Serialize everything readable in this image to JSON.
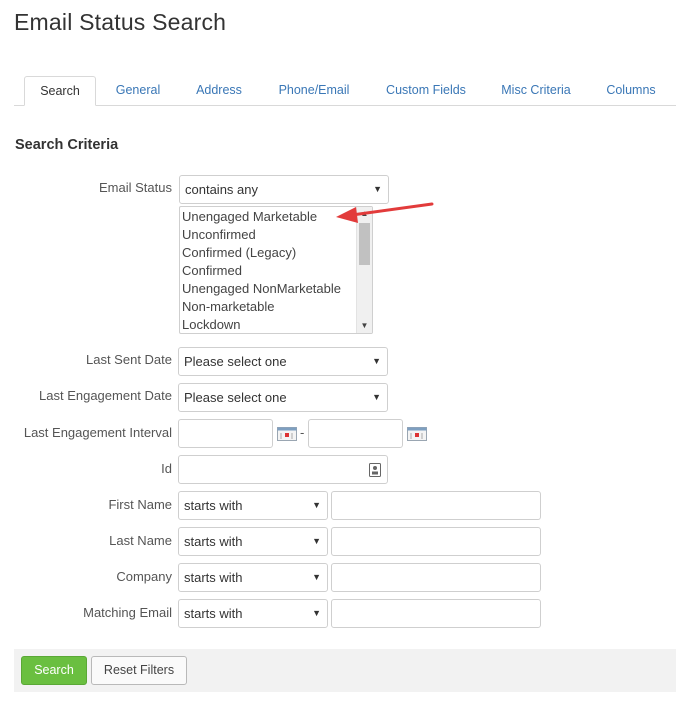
{
  "page": {
    "title": "Email Status Search"
  },
  "tabs": [
    {
      "label": "Search"
    },
    {
      "label": "General"
    },
    {
      "label": "Address"
    },
    {
      "label": "Phone/Email"
    },
    {
      "label": "Custom Fields"
    },
    {
      "label": "Misc Criteria"
    },
    {
      "label": "Columns"
    }
  ],
  "section": {
    "title": "Search Criteria"
  },
  "email_status": {
    "label": "Email Status",
    "operator": "contains any",
    "options": [
      "Unengaged Marketable",
      "Unconfirmed",
      "Confirmed (Legacy)",
      "Confirmed",
      "Unengaged NonMarketable",
      "Non-marketable",
      "Lockdown"
    ]
  },
  "last_sent_date": {
    "label": "Last Sent Date",
    "value": "Please select one"
  },
  "last_engagement_date": {
    "label": "Last Engagement Date",
    "value": "Please select one"
  },
  "last_engagement_interval": {
    "label": "Last Engagement Interval",
    "separator": "-"
  },
  "id_field": {
    "label": "Id"
  },
  "first_name": {
    "label": "First Name",
    "operator": "starts with"
  },
  "last_name": {
    "label": "Last Name",
    "operator": "starts with"
  },
  "company": {
    "label": "Company",
    "operator": "starts with"
  },
  "matching_email": {
    "label": "Matching Email",
    "operator": "starts with"
  },
  "buttons": {
    "search": "Search",
    "reset": "Reset Filters"
  },
  "colors": {
    "link": "#3a77b6",
    "primary_button": "#6abf40",
    "annotation_arrow": "#e23b3b"
  },
  "icons": [
    "calendar-icon",
    "id-card-icon",
    "dropdown-caret-icon",
    "annotation-arrow"
  ]
}
